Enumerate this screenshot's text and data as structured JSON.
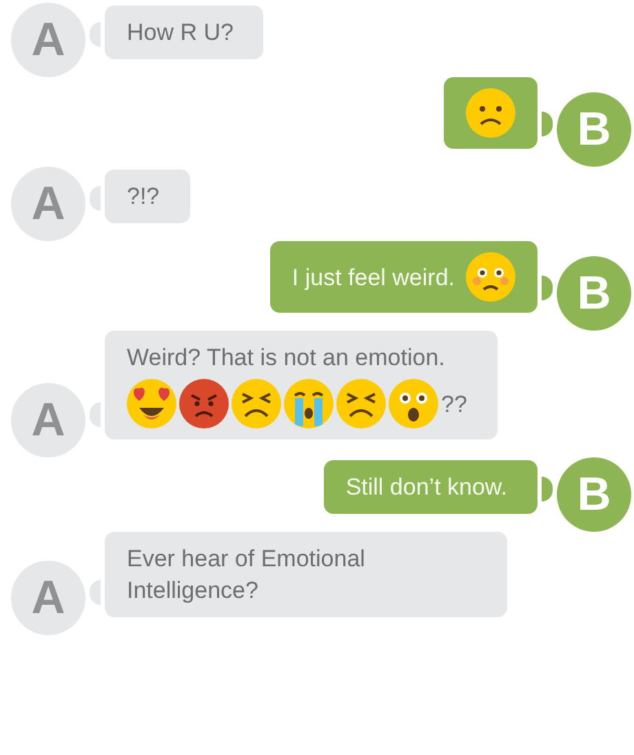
{
  "messages": [
    {
      "sender": "A",
      "kind": "incoming",
      "lines": [
        [
          {
            "kind": "text",
            "text": "How R U?"
          }
        ]
      ]
    },
    {
      "sender": "B",
      "kind": "outgoing",
      "lines": [
        [
          {
            "kind": "frown"
          }
        ]
      ]
    },
    {
      "sender": "A",
      "kind": "incoming",
      "lines": [
        [
          {
            "kind": "text",
            "text": "?!?"
          }
        ]
      ]
    },
    {
      "sender": "B",
      "kind": "outgoing",
      "lines": [
        [
          {
            "kind": "text",
            "text": "I just feel weird."
          },
          {
            "kind": "flushed"
          }
        ]
      ]
    },
    {
      "sender": "A",
      "kind": "incoming",
      "lines": [
        [
          {
            "kind": "text",
            "text": "Weird? That is not an emotion."
          }
        ],
        [
          {
            "kind": "hearteyes"
          },
          {
            "kind": "angry"
          },
          {
            "kind": "squint"
          },
          {
            "kind": "crying"
          },
          {
            "kind": "squint"
          },
          {
            "kind": "astonished"
          },
          {
            "kind": "text",
            "text": "??"
          }
        ]
      ]
    },
    {
      "sender": "B",
      "kind": "outgoing",
      "lines": [
        [
          {
            "kind": "text",
            "text": "Still don’t know."
          }
        ]
      ]
    },
    {
      "sender": "A",
      "kind": "incoming",
      "lines": [
        [
          {
            "kind": "text",
            "text": "Ever hear of Emotional Intelligence?"
          }
        ]
      ]
    }
  ]
}
